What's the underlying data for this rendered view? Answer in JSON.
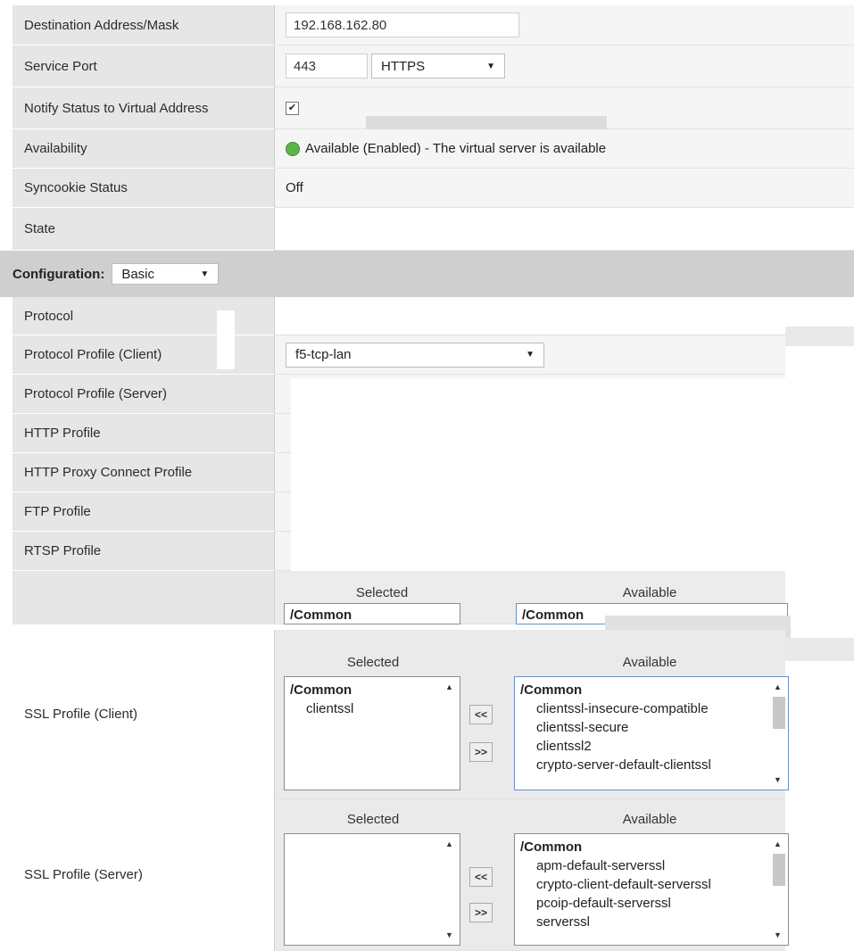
{
  "general": {
    "destination_label": "Destination Address/Mask",
    "destination_value": "192.168.162.80",
    "service_port_label": "Service Port",
    "service_port_value": "443",
    "service_port_protocol": "HTTPS",
    "notify_label": "Notify Status to Virtual Address",
    "notify_checked": "✔",
    "availability_label": "Availability",
    "availability_value": "Available (Enabled) - The virtual server is available",
    "syncookie_label": "Syncookie Status",
    "syncookie_value": "Off",
    "state_label": "State"
  },
  "configuration": {
    "label": "Configuration:",
    "mode": "Basic"
  },
  "profiles": {
    "protocol_label": "Protocol",
    "client_label": "Protocol Profile (Client)",
    "client_value": "f5-tcp-lan",
    "server_label": "Protocol Profile (Server)",
    "http_label": "HTTP Profile",
    "http_proxy_label": "HTTP Proxy Connect Profile",
    "ftp_label": "FTP Profile",
    "rtsp_label": "RTSP Profile",
    "partial_selected": "Selected",
    "partial_available": "Available",
    "partial_common_left": "/Common",
    "partial_common_right": "/Common"
  },
  "ssl_client": {
    "label": "SSL Profile (Client)",
    "selected_header": "Selected",
    "available_header": "Available",
    "selected_items": [
      {
        "text": "/Common",
        "kind": "group"
      },
      {
        "text": "clientssl",
        "kind": "indent"
      }
    ],
    "available_items": [
      {
        "text": "/Common",
        "kind": "group"
      },
      {
        "text": "clientssl-insecure-compatible",
        "kind": "indent"
      },
      {
        "text": "clientssl-secure",
        "kind": "indent"
      },
      {
        "text": "clientssl2",
        "kind": "indent"
      },
      {
        "text": "crypto-server-default-clientssl",
        "kind": "indent"
      }
    ],
    "move_left": "<<",
    "move_right": ">>"
  },
  "ssl_server": {
    "label": "SSL Profile (Server)",
    "selected_header": "Selected",
    "available_header": "Available",
    "selected_items": [],
    "available_items": [
      {
        "text": "/Common",
        "kind": "group"
      },
      {
        "text": "apm-default-serverssl",
        "kind": "indent"
      },
      {
        "text": "crypto-client-default-serverssl",
        "kind": "indent"
      },
      {
        "text": "pcoip-default-serverssl",
        "kind": "indent"
      },
      {
        "text": "serverssl",
        "kind": "indent"
      }
    ],
    "move_left": "<<",
    "move_right": ">>"
  },
  "icons": {
    "dropdown": "▼",
    "scroll_up": "▲",
    "scroll_down": "▼",
    "status": "green-circle"
  },
  "colors": {
    "label_bg": "#e6e6e6",
    "value_bg": "#f5f5f5",
    "available_green": "#5cb548",
    "listbox_focus": "#6b8fc7"
  }
}
